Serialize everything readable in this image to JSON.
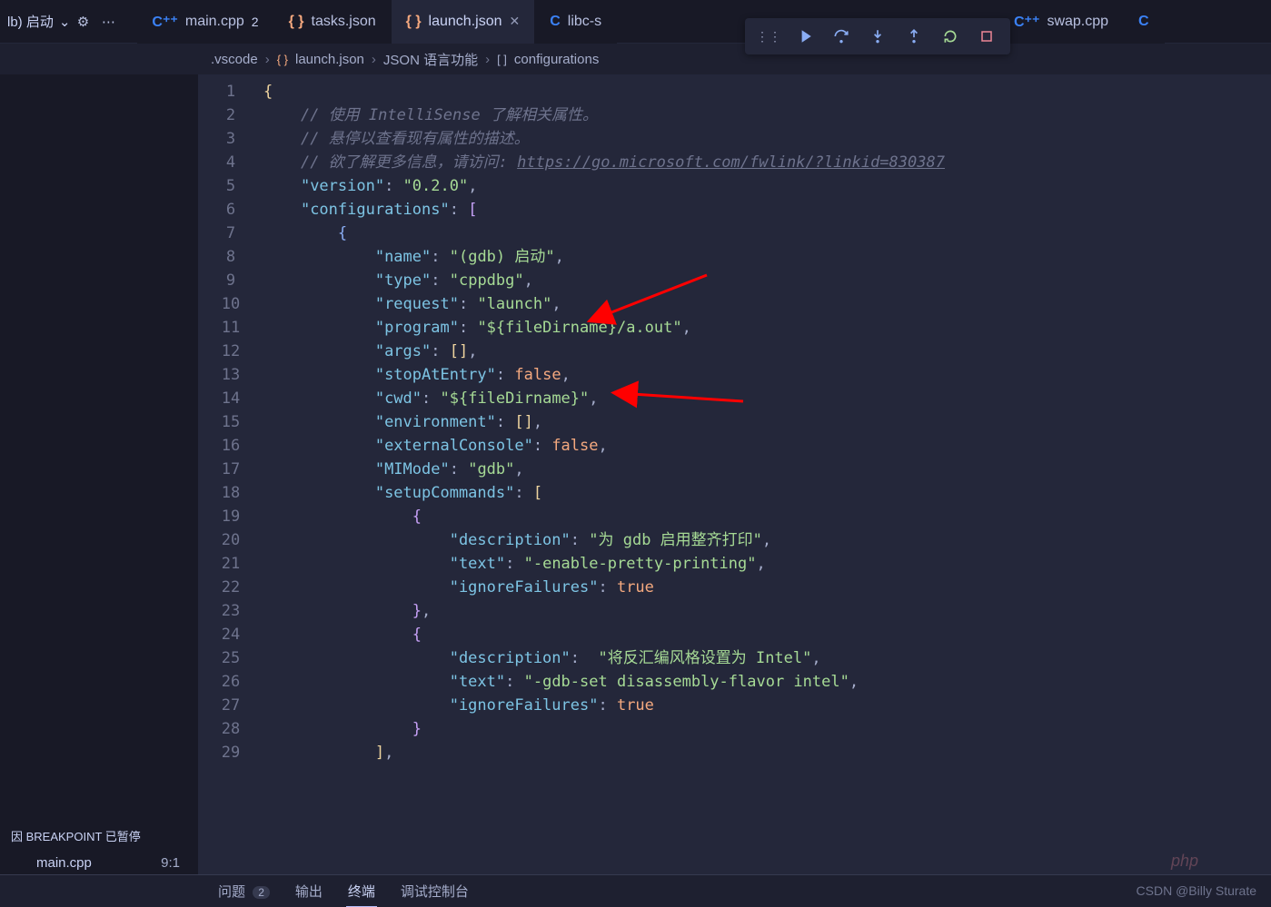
{
  "debug": {
    "config_label": "lb) 启动",
    "toolbar_icons": [
      "grip",
      "continue",
      "step-over",
      "step-into",
      "step-out",
      "restart",
      "stop"
    ]
  },
  "tabs": [
    {
      "icon": "cpp",
      "label": "main.cpp",
      "dirty": "2",
      "active": false
    },
    {
      "icon": "json",
      "label": "tasks.json",
      "active": false
    },
    {
      "icon": "json",
      "label": "launch.json",
      "active": true
    },
    {
      "icon": "c",
      "label": "libc-s",
      "active": false
    },
    {
      "icon": "cpp",
      "label": "swap.cpp",
      "active": false
    },
    {
      "icon": "c",
      "label": "",
      "active": false
    }
  ],
  "breadcrumbs": {
    "folder": ".vscode",
    "file": "launch.json",
    "lang": "JSON 语言功能",
    "node": "configurations"
  },
  "sidebar": {
    "pause_reason": "因 BREAKPOINT 已暂停",
    "stack_file": "main.cpp",
    "stack_loc": "9:1"
  },
  "bottom": {
    "problems": "问题",
    "problems_count": "2",
    "output": "输出",
    "terminal": "终端",
    "debug_console": "调试控制台"
  },
  "code": {
    "comment1": "// 使用 IntelliSense 了解相关属性。",
    "comment2": "// 悬停以查看现有属性的描述。",
    "comment3_pre": "// 欲了解更多信息，请访问: ",
    "comment3_link": "https://go.microsoft.com/fwlink/?linkid=830387",
    "k_version": "\"version\"",
    "v_version": "\"0.2.0\"",
    "k_configurations": "\"configurations\"",
    "k_name": "\"name\"",
    "v_name": "\"(gdb) 启动\"",
    "k_type": "\"type\"",
    "v_type": "\"cppdbg\"",
    "k_request": "\"request\"",
    "v_request": "\"launch\"",
    "k_program": "\"program\"",
    "v_program": "\"${fileDirname}/a.out\"",
    "k_args": "\"args\"",
    "k_stopAtEntry": "\"stopAtEntry\"",
    "v_false": "false",
    "k_cwd": "\"cwd\"",
    "v_cwd": "\"${fileDirname}\"",
    "k_env": "\"environment\"",
    "k_extConsole": "\"externalConsole\"",
    "k_mimode": "\"MIMode\"",
    "v_mimode": "\"gdb\"",
    "k_setup": "\"setupCommands\"",
    "k_desc": "\"description\"",
    "v_desc1": "\"为 gdb 启用整齐打印\"",
    "k_text": "\"text\"",
    "v_text1": "\"-enable-pretty-printing\"",
    "k_ignore": "\"ignoreFailures\"",
    "v_true": "true",
    "v_desc2": "\"将反汇编风格设置为 Intel\"",
    "v_text2": "\"-gdb-set disassembly-flavor intel\""
  },
  "watermark": "CSDN @Billy Sturate"
}
